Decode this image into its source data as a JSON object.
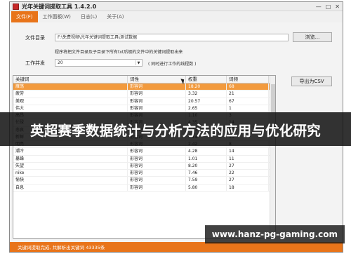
{
  "window": {
    "title": "光年关键词提取工具 1.4.2.0"
  },
  "menu": [
    "文件(F)",
    "工作面板(W)",
    "日志(L)",
    "关于(A)"
  ],
  "form": {
    "dir_label": "文件目录",
    "dir_value": "F:\\免费视频\\光年关键词提取工具\\测试数据",
    "browse_label": "浏览...",
    "hint": "程序将把文件目录及子目录下所有txt后缀的文件中的关键词提取出来",
    "concurrency_label": "工作并发",
    "concurrency_value": "20",
    "concurrency_note": "( 同时进行工作的线程数 )",
    "export_label": "导出为CSV"
  },
  "table": {
    "headers": [
      "关键词",
      "词性",
      "权重",
      "词频"
    ],
    "rows": [
      [
        "雁荡",
        "形容词",
        "18.20",
        "68"
      ],
      [
        "疲劳",
        "形容词",
        "3.32",
        "21"
      ],
      [
        "美观",
        "形容词",
        "20.57",
        "67"
      ],
      [
        "伟大",
        "形容词",
        "2.65",
        "1"
      ],
      [
        "高昂",
        "形容词",
        "1.10",
        "3"
      ],
      [
        "忙碌",
        "形容词",
        "4.35",
        "14"
      ],
      [
        "悲哀",
        "形容词",
        "2.43",
        "8"
      ],
      [
        "新鲜",
        "形容词",
        "3.14",
        "10"
      ],
      [
        "明亮",
        "形容词",
        "2.42",
        "8"
      ],
      [
        "潮冷",
        "形容词",
        "4.28",
        "14"
      ],
      [
        "暴躁",
        "形容词",
        "1.01",
        "11"
      ],
      [
        "失望",
        "形容词",
        "8.20",
        "27"
      ],
      [
        "nike",
        "形容词",
        "7.46",
        "22"
      ],
      [
        "愉快",
        "形容词",
        "7.59",
        "27"
      ],
      [
        "自息",
        "形容词",
        "5.80",
        "18"
      ]
    ]
  },
  "status": "关键词提取完成, 共解析出关键词 43335条",
  "overlay": {
    "banner": "英超赛季数据统计与分析方法的应用与优化研究",
    "watermark": "www.hanz-pg-gaming.com"
  }
}
